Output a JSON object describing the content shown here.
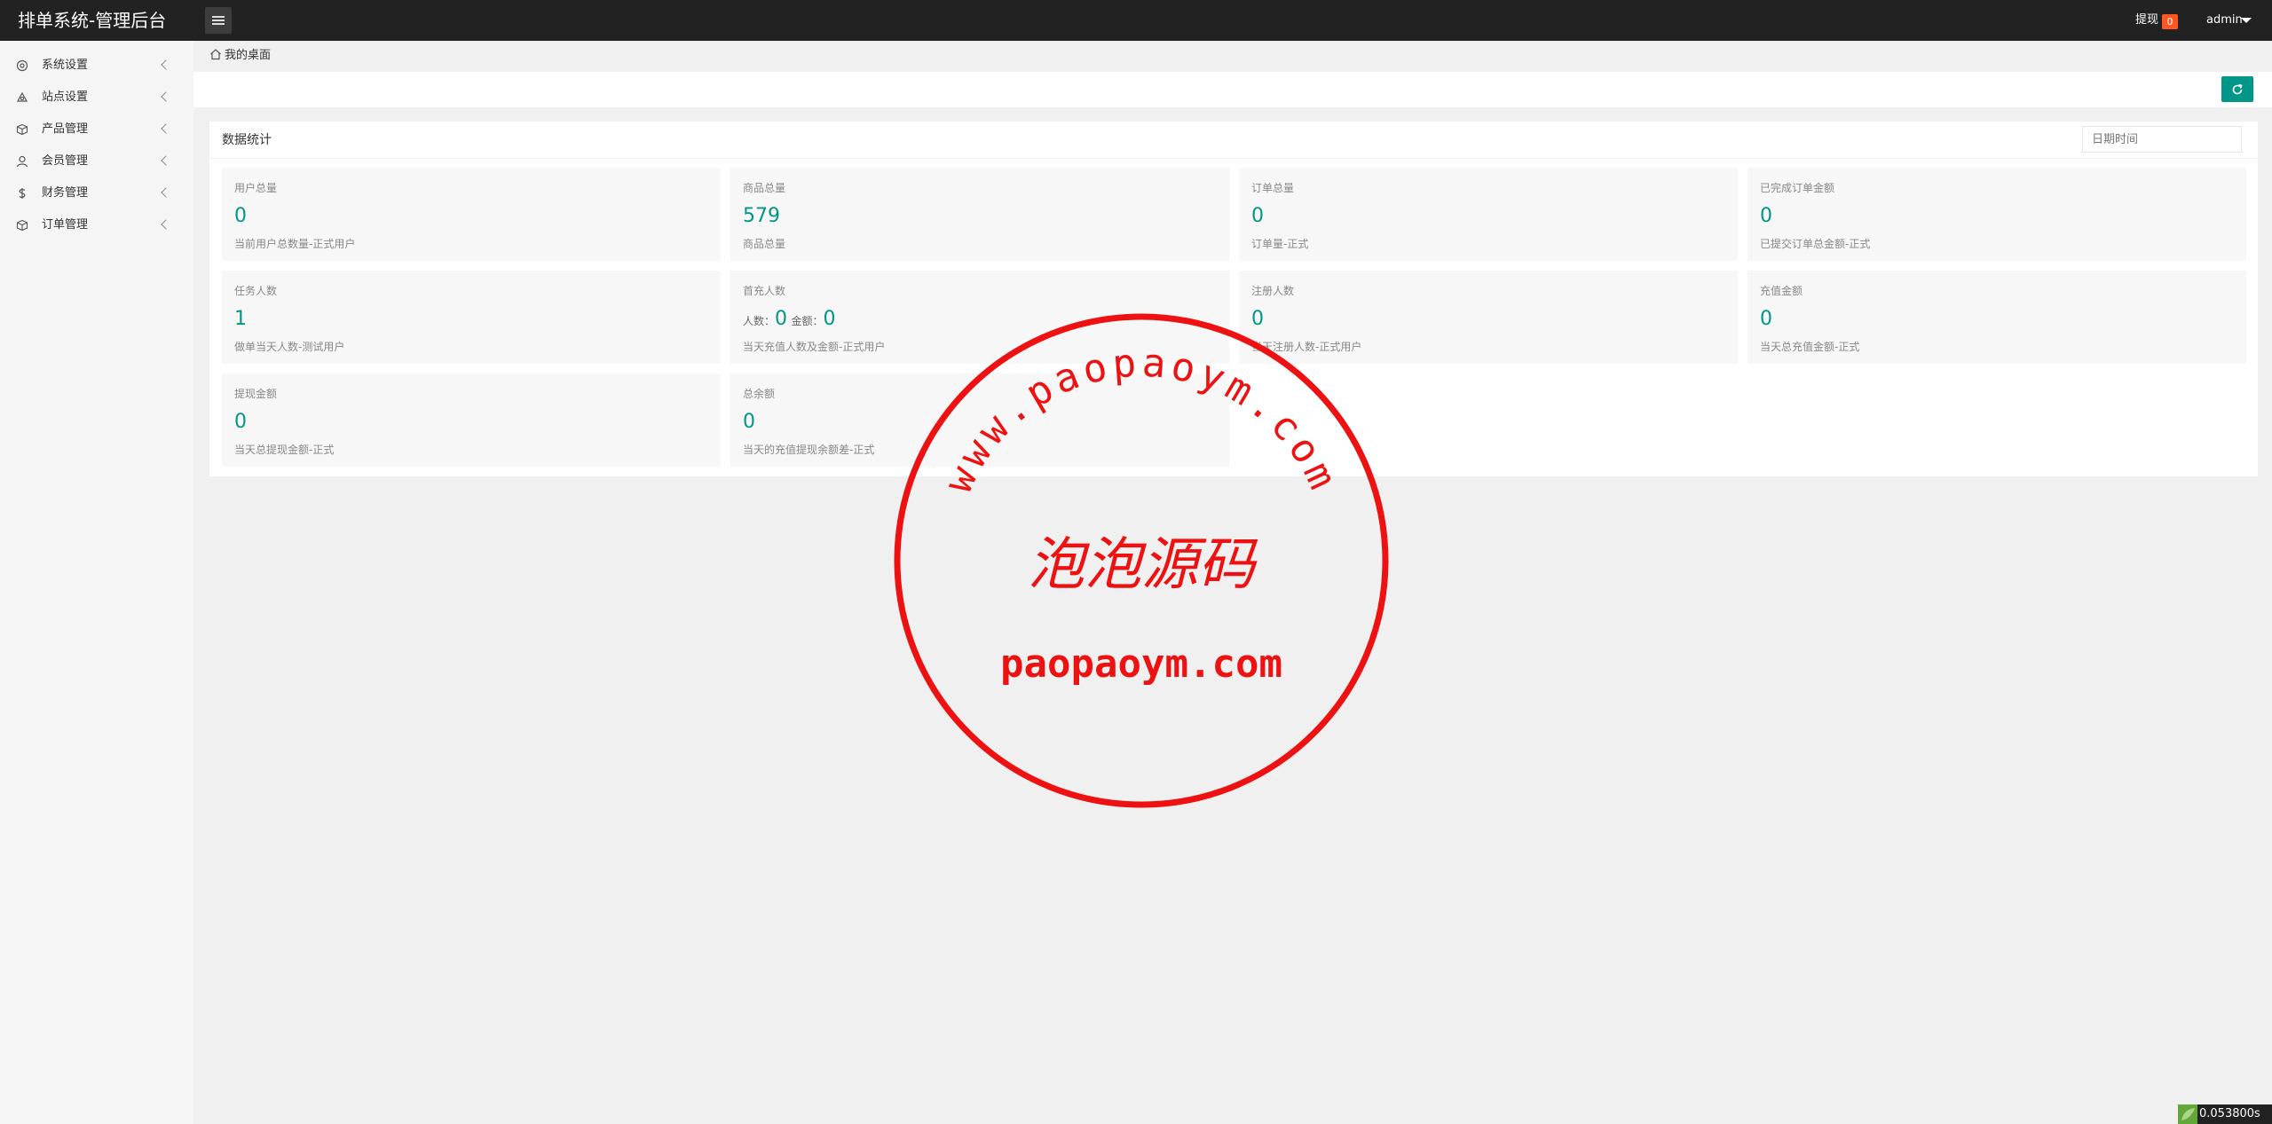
{
  "header": {
    "brand": "排单系统-管理后台",
    "withdraw_label": "提现",
    "withdraw_badge": "0",
    "user_name": "admin"
  },
  "sidebar": {
    "items": [
      {
        "label": "系统设置",
        "icon": "gear-icon"
      },
      {
        "label": "站点设置",
        "icon": "site-icon"
      },
      {
        "label": "产品管理",
        "icon": "box-icon"
      },
      {
        "label": "会员管理",
        "icon": "user-icon"
      },
      {
        "label": "财务管理",
        "icon": "dollar-icon"
      },
      {
        "label": "订单管理",
        "icon": "order-icon"
      }
    ]
  },
  "breadcrumb": {
    "label": "我的桌面"
  },
  "panel": {
    "title": "数据统计",
    "date_placeholder": "日期时间"
  },
  "stats": [
    {
      "title": "用户总量",
      "value": "0",
      "sub": "当前用户总数量-正式用户"
    },
    {
      "title": "商品总量",
      "value": "579",
      "sub": "商品总量"
    },
    {
      "title": "订单总量",
      "value": "0",
      "sub": "订单量-正式"
    },
    {
      "title": "已完成订单金额",
      "value": "0",
      "sub": "已提交订单总金额-正式"
    },
    {
      "title": "任务人数",
      "value": "1",
      "sub": "做单当天人数-测试用户"
    },
    {
      "title": "首充人数",
      "count_label": "人数：",
      "count_value": "0",
      "amount_label": "金额：",
      "amount_value": "0",
      "sub": "当天充值人数及金额-正式用户"
    },
    {
      "title": "注册人数",
      "value": "0",
      "sub": "当天注册人数-正式用户"
    },
    {
      "title": "充值金额",
      "value": "0",
      "sub": "当天总充值金额-正式"
    },
    {
      "title": "提现金额",
      "value": "0",
      "sub": "当天总提现金额-正式"
    },
    {
      "title": "总余额",
      "value": "0",
      "sub": "当天的充值提现余额差-正式"
    }
  ],
  "watermark": {
    "arc_text": "www.paopaoym.com",
    "center_text": "泡泡源码",
    "bottom_text": "paopaoym.com",
    "color": "#ee1111"
  },
  "timer": {
    "value": "0.053800s"
  },
  "colors": {
    "accent": "#009688",
    "topbar": "#222222",
    "badge": "#ff5722"
  }
}
